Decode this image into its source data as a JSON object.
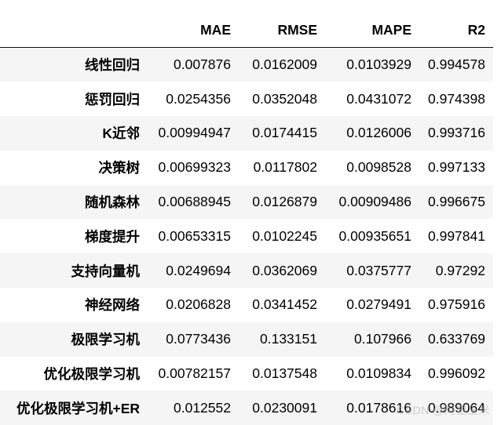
{
  "table": {
    "headers": [
      "",
      "MAE",
      "RMSE",
      "MAPE",
      "R2"
    ],
    "rows": [
      {
        "label": "线性回归",
        "values": [
          "0.007876",
          "0.0162009",
          "0.0103929",
          "0.994578"
        ]
      },
      {
        "label": "惩罚回归",
        "values": [
          "0.0254356",
          "0.0352048",
          "0.0431072",
          "0.974398"
        ]
      },
      {
        "label": "K近邻",
        "values": [
          "0.00994947",
          "0.0174415",
          "0.0126006",
          "0.993716"
        ]
      },
      {
        "label": "决策树",
        "values": [
          "0.00699323",
          "0.0117802",
          "0.0098528",
          "0.997133"
        ]
      },
      {
        "label": "随机森林",
        "values": [
          "0.00688945",
          "0.0126879",
          "0.00909486",
          "0.996675"
        ]
      },
      {
        "label": "梯度提升",
        "values": [
          "0.00653315",
          "0.0102245",
          "0.00935651",
          "0.997841"
        ]
      },
      {
        "label": "支持向量机",
        "values": [
          "0.0249694",
          "0.0362069",
          "0.0375777",
          "0.97292"
        ]
      },
      {
        "label": "神经网络",
        "values": [
          "0.0206828",
          "0.0341452",
          "0.0279491",
          "0.975916"
        ]
      },
      {
        "label": "极限学习机",
        "values": [
          "0.0773436",
          "0.133151",
          "0.107966",
          "0.633769"
        ]
      },
      {
        "label": "优化极限学习机",
        "values": [
          "0.00782157",
          "0.0137548",
          "0.0109834",
          "0.996092"
        ]
      },
      {
        "label": "优化极限学习机+ER",
        "values": [
          "0.012552",
          "0.0230091",
          "0.0178616",
          "0.989064"
        ]
      }
    ]
  },
  "watermark": "CSDN @阿里玉米"
}
